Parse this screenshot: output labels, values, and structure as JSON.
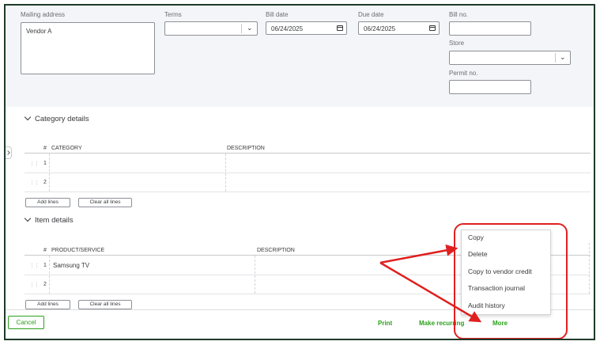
{
  "form": {
    "mailing_address_label": "Mailing address",
    "mailing_address_value": "Vendor A",
    "terms_label": "Terms",
    "terms_value": "",
    "bill_date_label": "Bill date",
    "bill_date_value": "06/24/2025",
    "due_date_label": "Due date",
    "due_date_value": "06/24/2025",
    "bill_no_label": "Bill no.",
    "bill_no_value": "",
    "store_label": "Store",
    "store_value": "",
    "permit_no_label": "Permit no.",
    "permit_no_value": ""
  },
  "category_section": {
    "title": "Category details",
    "col_num": "#",
    "col_category": "CATEGORY",
    "col_description": "DESCRIPTION",
    "rows": [
      {
        "num": "1",
        "category": "",
        "description": ""
      },
      {
        "num": "2",
        "category": "",
        "description": ""
      }
    ],
    "add_lines": "Add lines",
    "clear_all": "Clear all lines"
  },
  "item_section": {
    "title": "Item details",
    "col_num": "#",
    "col_product": "PRODUCT/SERVICE",
    "col_description": "DESCRIPTION",
    "rows": [
      {
        "num": "1",
        "product": "Samsung TV",
        "description": ""
      },
      {
        "num": "2",
        "product": "",
        "description": ""
      }
    ],
    "add_lines": "Add lines",
    "clear_all": "Clear all lines"
  },
  "footer": {
    "cancel": "Cancel",
    "print": "Print",
    "make_recurring": "Make recurring",
    "more": "More"
  },
  "more_menu": {
    "items": [
      "Copy",
      "Delete",
      "Copy to vendor credit",
      "Transaction journal",
      "Audit history"
    ]
  },
  "colors": {
    "brand_green": "#2ca01c",
    "annotation_red": "#e02020",
    "header_bg": "#f4f5f8"
  },
  "icons": {
    "dropdown": "chevron-down-icon",
    "calendar": "calendar-icon",
    "drag": "drag-handle-icon"
  }
}
